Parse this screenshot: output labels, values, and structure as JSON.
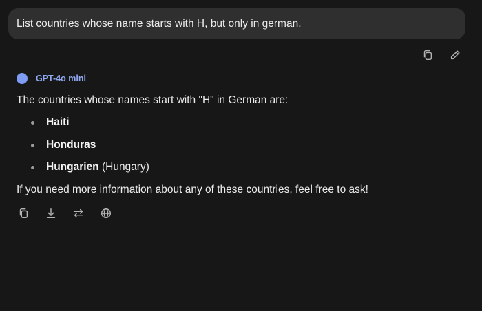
{
  "user_message": "List countries whose name starts with H, but only in german.",
  "user_actions": [
    "copy-icon",
    "edit-icon"
  ],
  "model": {
    "name": "GPT-4o mini",
    "color": "#7f9cf5"
  },
  "answer": {
    "intro": "The countries whose names start with \"H\" in German are:",
    "items": [
      {
        "name": "Haiti",
        "note": ""
      },
      {
        "name": "Honduras",
        "note": ""
      },
      {
        "name": "Hungarien",
        "note": " (Hungary)"
      }
    ],
    "closing": "If you need more information about any of these countries, feel free to ask!"
  },
  "bot_actions": [
    "copy-icon",
    "download-icon",
    "regenerate-icon",
    "globe-icon"
  ]
}
